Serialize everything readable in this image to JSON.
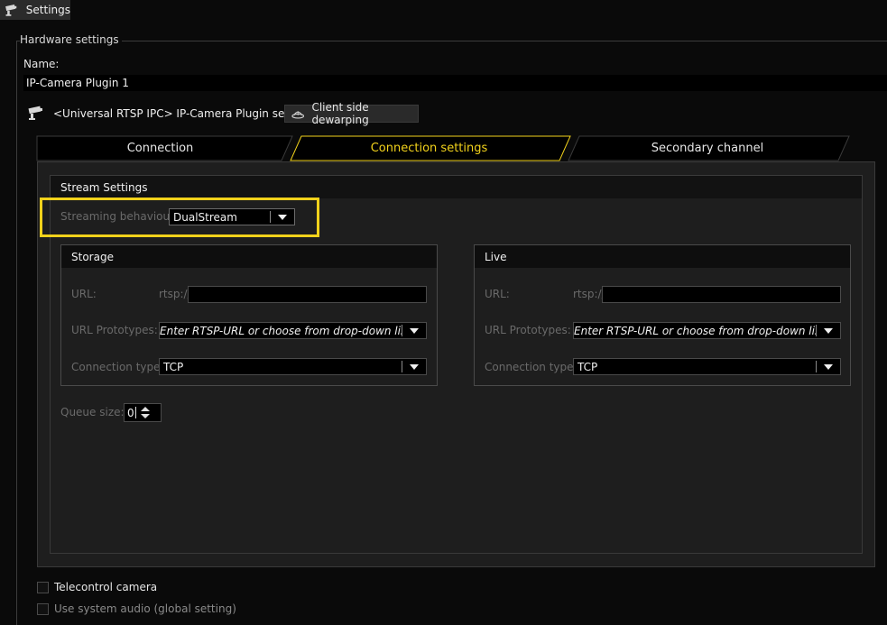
{
  "window": {
    "title": "Settings"
  },
  "hardware": {
    "group_title": "Hardware settings",
    "name_label": "Name:",
    "name_value": "IP-Camera Plugin 1",
    "plugin_label": "<Universal RTSP IPC> IP-Camera Plugin settings",
    "dewarp_button": "Client side dewarping"
  },
  "tabs": [
    {
      "label": "Connection",
      "active": false
    },
    {
      "label": "Connection settings",
      "active": true
    },
    {
      "label": "Secondary channel",
      "active": false
    }
  ],
  "stream_settings": {
    "title": "Stream Settings",
    "streaming_behaviour_label": "Streaming behaviour:",
    "streaming_behaviour_value": "DualStream",
    "storage": {
      "title": "Storage",
      "url_label": "URL:",
      "url_prefix": "rtsp://",
      "url_value": "",
      "prototypes_label": "URL Prototypes:",
      "prototypes_value": "Enter RTSP-URL or choose from drop-down list",
      "connection_type_label": "Connection type:",
      "connection_type_value": "TCP"
    },
    "live": {
      "title": "Live",
      "url_label": "URL:",
      "url_prefix": "rtsp://",
      "url_value": "",
      "prototypes_label": "URL Prototypes:",
      "prototypes_value": "Enter RTSP-URL or choose from drop-down list",
      "connection_type_label": "Connection type:",
      "connection_type_value": "TCP"
    },
    "queue_size_label": "Queue size:",
    "queue_size_value": "0"
  },
  "checkboxes": {
    "telecontrol": {
      "label": "Telecontrol camera",
      "checked": false
    },
    "system_audio": {
      "label": "Use system audio (global setting)",
      "checked": false
    }
  },
  "colors": {
    "accent": "#f2d21b",
    "background": "#0a0a0a",
    "panel": "#1e1e1e"
  }
}
